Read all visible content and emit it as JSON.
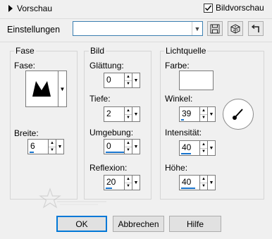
{
  "header": {
    "preview_toggle_label": "Vorschau",
    "image_preview_label": "Bildvorschau",
    "image_preview_checked": true
  },
  "settings": {
    "label": "Einstellungen",
    "combo_value": ""
  },
  "groups": {
    "fase": {
      "title": "Fase",
      "fase_label": "Fase:",
      "breite_label": "Breite:",
      "breite_value": "6"
    },
    "bild": {
      "title": "Bild",
      "glaettung_label": "Glättung:",
      "glaettung_value": "0",
      "tiefe_label": "Tiefe:",
      "tiefe_value": "2",
      "umgebung_label": "Umgebung:",
      "umgebung_value": "0",
      "reflexion_label": "Reflexion:",
      "reflexion_value": "20"
    },
    "licht": {
      "title": "Lichtquelle",
      "farbe_label": "Farbe:",
      "farbe_color": "#ffffff",
      "winkel_label": "Winkel:",
      "winkel_value": "39",
      "intensitaet_label": "Intensität:",
      "intensitaet_value": "40",
      "hoehe_label": "Höhe:",
      "hoehe_value": "40"
    }
  },
  "buttons": {
    "ok": "OK",
    "cancel": "Abbrechen",
    "help": "Hilfe"
  },
  "colors": {
    "accent": "#0078d7",
    "slider_bar": "#1874cd"
  },
  "icons": [
    "triangle-right-icon",
    "checkmark-icon",
    "chevron-down-icon",
    "save-icon",
    "cube-icon",
    "undo-icon",
    "light-dial-icon"
  ]
}
